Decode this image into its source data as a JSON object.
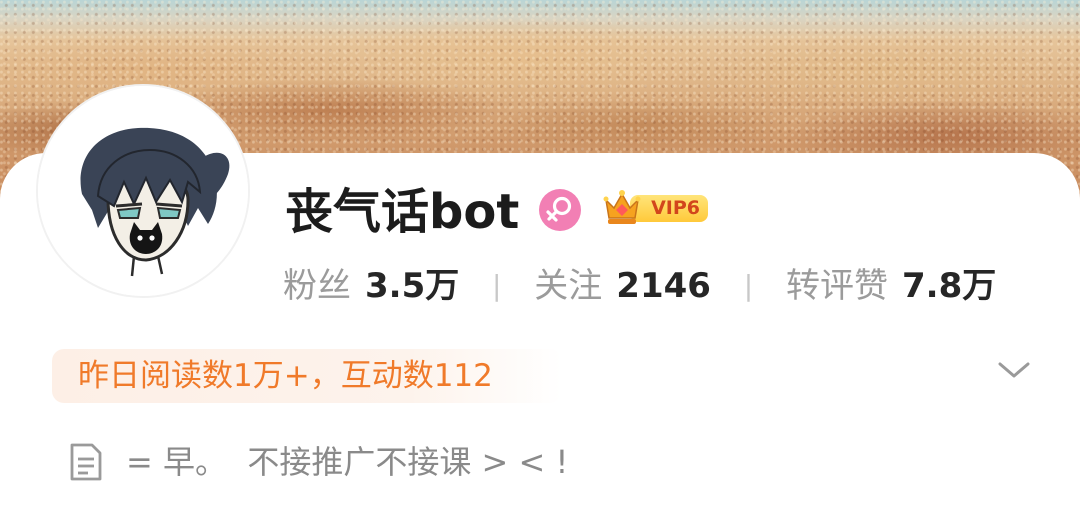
{
  "profile": {
    "name": "丧气话bot",
    "gender_icon": "female-icon",
    "vip": {
      "icon": "crown-icon",
      "label": "VIP6"
    }
  },
  "stats": [
    {
      "label": "粉丝",
      "value": "3.5万"
    },
    {
      "label": "关注",
      "value": "2146"
    },
    {
      "label": "转评赞",
      "value": "7.8万"
    }
  ],
  "stat_separator": "|",
  "reading_summary": "昨日阅读数1万+，互动数112",
  "expand_icon": "chevron-down-icon",
  "bio": {
    "icon": "document-icon",
    "text": "= 早。  不接推广不接课 > < !"
  },
  "colors": {
    "accent": "#f07a2a",
    "reading_bg": "#fdefe6",
    "gender": "#f27fb4",
    "vip_gold": "#ffc93a",
    "vip_text": "#d2461c",
    "name_text": "#1c1c1c",
    "muted_text": "#9b9b9b"
  }
}
